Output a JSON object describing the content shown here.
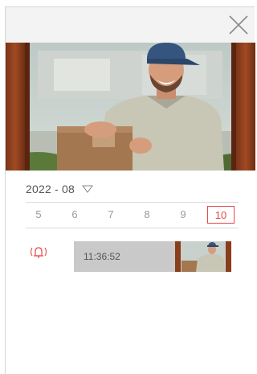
{
  "header": {
    "close_icon": "close-icon"
  },
  "preview": {
    "image": "camera-snapshot-delivery-person"
  },
  "date_selector": {
    "value": "2022 - 08",
    "icon": "triangle-down-icon"
  },
  "days": [
    {
      "label": "5",
      "selected": false
    },
    {
      "label": "6",
      "selected": false
    },
    {
      "label": "7",
      "selected": false
    },
    {
      "label": "8",
      "selected": false
    },
    {
      "label": "9",
      "selected": false
    },
    {
      "label": "10",
      "selected": true
    }
  ],
  "events": [
    {
      "type_icon": "doorbell-alarm-icon",
      "time": "11:36:52",
      "thumbnail": "event-thumbnail"
    }
  ],
  "colors": {
    "accent": "#e6484c",
    "event_bar": "#c9c9c9",
    "topbar": "#f3f3f3"
  }
}
